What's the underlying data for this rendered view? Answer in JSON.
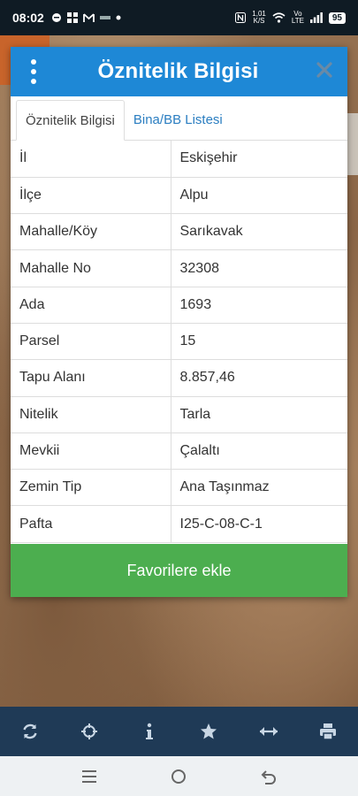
{
  "status_bar": {
    "time": "08:02",
    "network_speed_value": "1,01",
    "network_speed_unit": "K/S",
    "volte": "Vo LTE",
    "battery": "95"
  },
  "dialog": {
    "title": "Öznitelik Bilgisi",
    "tabs": [
      {
        "label": "Öznitelik Bilgisi",
        "active": true
      },
      {
        "label": "Bina/BB Listesi",
        "active": false
      }
    ],
    "rows": [
      {
        "key": "İl",
        "value": "Eskişehir"
      },
      {
        "key": "İlçe",
        "value": "Alpu"
      },
      {
        "key": "Mahalle/Köy",
        "value": "Sarıkavak"
      },
      {
        "key": "Mahalle No",
        "value": "32308"
      },
      {
        "key": "Ada",
        "value": "1693"
      },
      {
        "key": "Parsel",
        "value": "15"
      },
      {
        "key": "Tapu Alanı",
        "value": "8.857,46"
      },
      {
        "key": "Nitelik",
        "value": "Tarla"
      },
      {
        "key": "Mevkii",
        "value": "Çalaltı"
      },
      {
        "key": "Zemin Tip",
        "value": "Ana Taşınmaz"
      },
      {
        "key": "Pafta",
        "value": "I25-C-08-C-1"
      }
    ],
    "favorite_button": "Favorilere ekle"
  },
  "toolbar": {
    "tools": [
      "refresh-icon",
      "locate-icon",
      "info-icon",
      "star-icon",
      "measure-icon",
      "print-icon"
    ]
  },
  "colors": {
    "header": "#1e88d6",
    "favorite": "#4cae4f",
    "toolbar": "#1f3a56"
  }
}
